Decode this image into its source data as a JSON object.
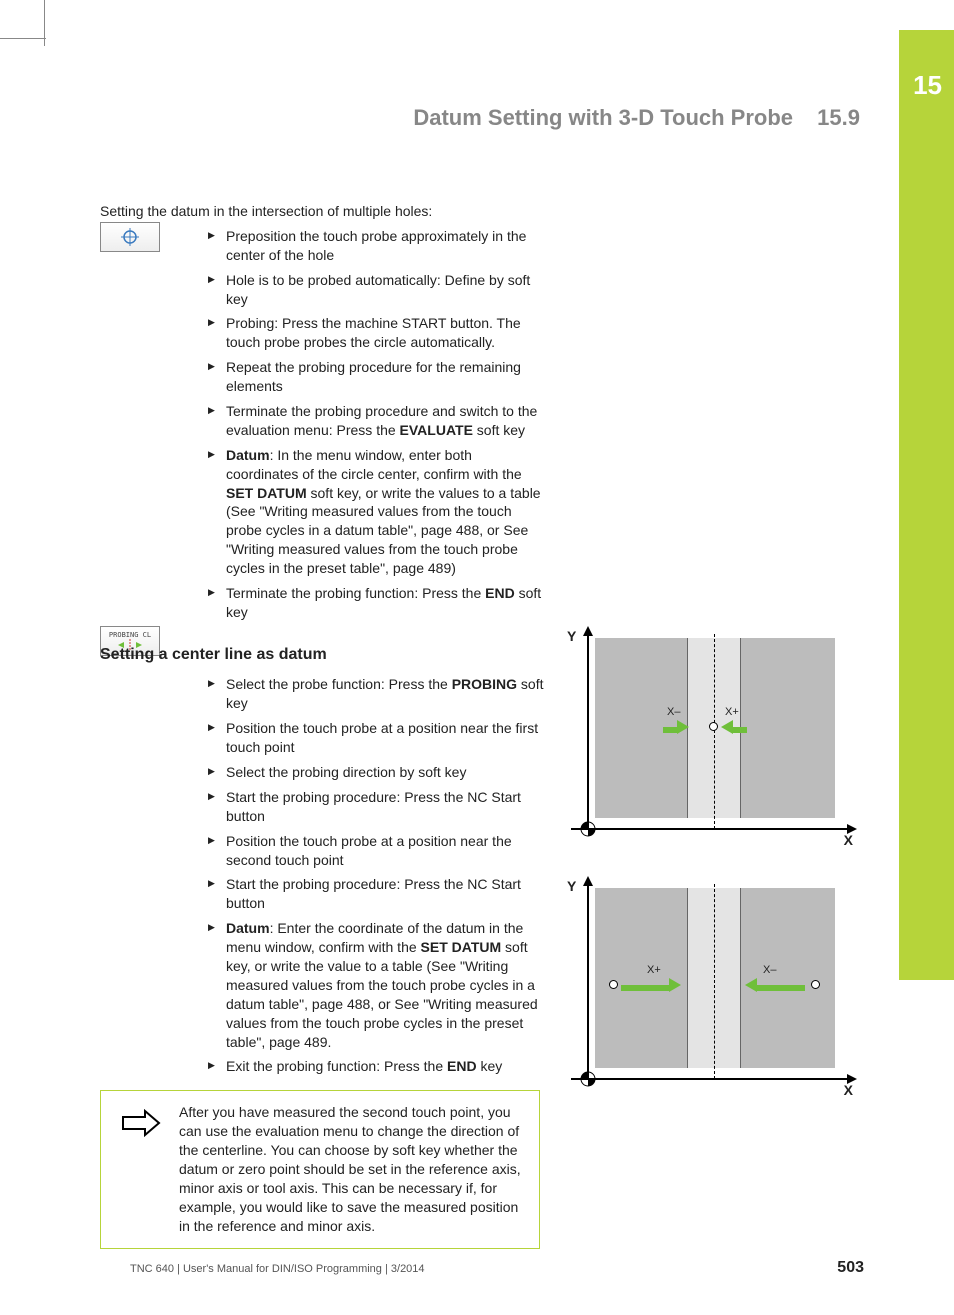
{
  "chapter_number": "15",
  "header": {
    "title": "Datum Setting with 3-D Touch Probe",
    "section": "15.9"
  },
  "intro": "Setting the datum in the intersection of multiple holes:",
  "softkey1_alt": "Probe hole softkey",
  "softkey2_label": "PROBING CL",
  "list1": {
    "i0": "Preposition the touch probe approximately in the center of the hole",
    "i1": "Hole is to be probed automatically: Define by soft key",
    "i2": "Probing: Press the machine START button. The touch probe probes the circle automatically.",
    "i3": "Repeat the probing procedure for the remaining elements",
    "i4_pre": "Terminate the probing procedure and switch to the evaluation menu: Press the ",
    "i4_b": "EVALUATE",
    "i4_post": " soft key",
    "i5_b1": "Datum",
    "i5_mid1": ": In the menu window, enter both coordinates of the circle center, confirm with the ",
    "i5_b2": "SET DATUM",
    "i5_mid2": " soft key, or write the values to a table (See \"Writing measured values from the touch probe cycles in a datum table\", page 488, or See \"Writing measured values from the touch probe cycles in the preset table\", page 489)",
    "i6_pre": "Terminate the probing function: Press the ",
    "i6_b": "END",
    "i6_post": " soft key"
  },
  "section_heading": "Setting a center line as datum",
  "list2": {
    "i0_pre": "Select the probe function: Press the ",
    "i0_b": "PROBING",
    "i0_post": " soft key",
    "i1": "Position the touch probe at a position near the first touch point",
    "i2": "Select the probing direction by soft key",
    "i3": "Start the probing procedure: Press the NC Start button",
    "i4": "Position the touch probe at a position near the second touch point",
    "i5": "Start the probing procedure: Press the NC Start button",
    "i6_b1": "Datum",
    "i6_mid1": ": Enter the coordinate of the datum in the menu window, confirm with the ",
    "i6_b2": "SET DATUM",
    "i6_mid2": " soft key, or write the value to a table (See \"Writing measured values from the touch probe cycles in a datum table\", page 488, or See \"Writing measured values from the touch probe cycles in the preset table\", page 489.",
    "i7_pre": "Exit the probing function: Press the ",
    "i7_b": "END",
    "i7_post": " key"
  },
  "note": "After you have measured the second touch point, you can use the evaluation menu to change the direction of the centerline. You can choose by soft key whether the datum or zero point should be set in the reference axis, minor axis or tool axis. This can be necessary if, for example, you would like to save the measured position in the reference and minor axis.",
  "diagram_labels": {
    "X": "X",
    "Y": "Y",
    "Xminus": "X–",
    "Xplus": "X+"
  },
  "footer": "TNC 640 | User's Manual for DIN/ISO Programming | 3/2014",
  "page_number": "503"
}
